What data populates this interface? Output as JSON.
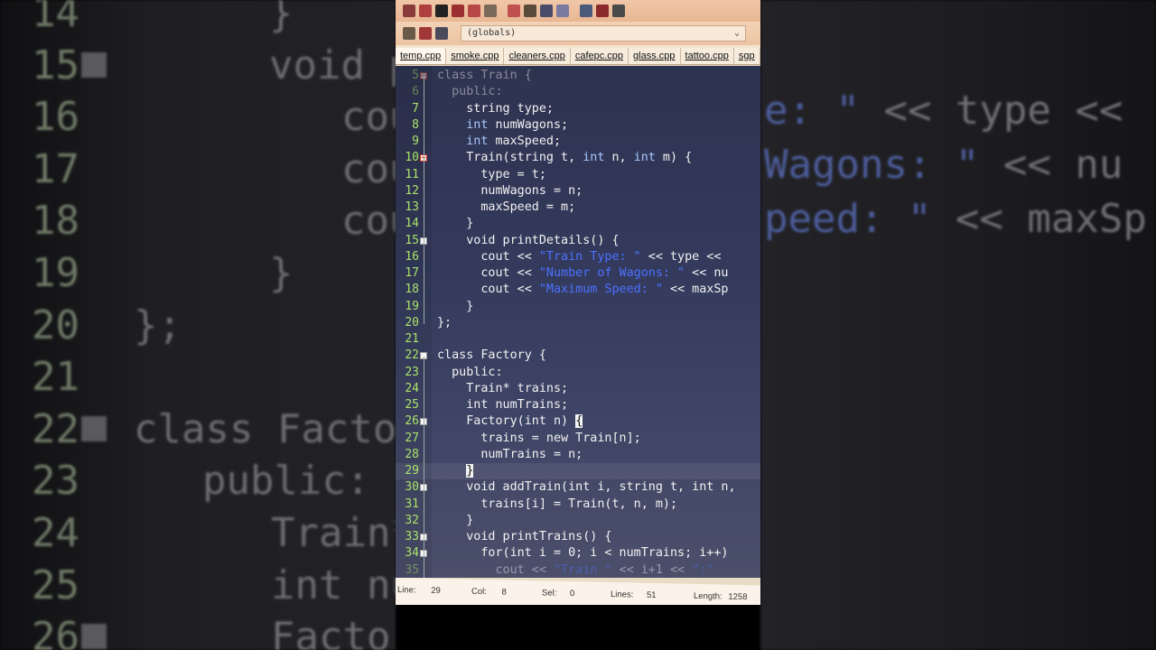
{
  "background_left": {
    "lines": [
      {
        "num": "14",
        "code": "}",
        "fold": false
      },
      {
        "num": "15",
        "code": "void p",
        "fold": true
      },
      {
        "num": "16",
        "code": "cou",
        "fold": false
      },
      {
        "num": "17",
        "code": "cou",
        "fold": false
      },
      {
        "num": "18",
        "code": "cou",
        "fold": false
      },
      {
        "num": "19",
        "code": "}",
        "fold": false
      },
      {
        "num": "20",
        "code": "};",
        "fold": false
      },
      {
        "num": "21",
        "code": "",
        "fold": false
      },
      {
        "num": "22",
        "code": "class Facto",
        "fold": true
      },
      {
        "num": "23",
        "code": "public:",
        "fold": false
      },
      {
        "num": "24",
        "code": "Train*",
        "fold": false
      },
      {
        "num": "25",
        "code": "int nu",
        "fold": false
      },
      {
        "num": "26",
        "code": "Facto",
        "fold": true
      }
    ]
  },
  "background_right": {
    "lines": [
      {
        "str": "e: \"",
        "plain": " << type <<"
      },
      {
        "str": "Wagons: \"",
        "plain": " << nu"
      },
      {
        "str": "peed: \"",
        "plain": " << maxSp"
      }
    ]
  },
  "toolbar": {
    "scope_value": "(globals)",
    "button_colors": [
      "#8a3a3a",
      "#b04040",
      "#222222",
      "#9c3030",
      "#b84848",
      "#7a6a5a",
      "#c05050",
      "#5a4a3a",
      "#4a4a6a",
      "#7a7aa0",
      "#4a5a7a",
      "#8a2a2a",
      "#4a4a4a"
    ]
  },
  "tabs": [
    "temp.cpp",
    "smoke.cpp",
    "cleaners.cpp",
    "cafepc.cpp",
    "glass.cpp",
    "tattoo.cpp",
    "sgp"
  ],
  "code_lines": [
    {
      "num": "5",
      "fold": "red",
      "segments": [
        {
          "t": "class Train {",
          "c": ""
        }
      ]
    },
    {
      "num": "6",
      "fold": "",
      "segments": [
        {
          "t": "  public:",
          "c": ""
        }
      ]
    },
    {
      "num": "7",
      "fold": "",
      "segments": [
        {
          "t": "    string type;",
          "c": ""
        }
      ]
    },
    {
      "num": "8",
      "fold": "",
      "segments": [
        {
          "t": "    int",
          "c": "kw"
        },
        {
          "t": " numWagons;",
          "c": ""
        }
      ]
    },
    {
      "num": "9",
      "fold": "",
      "segments": [
        {
          "t": "    int",
          "c": "kw"
        },
        {
          "t": " maxSpeed;",
          "c": ""
        }
      ]
    },
    {
      "num": "10",
      "fold": "red",
      "segments": [
        {
          "t": "    Train(string t, ",
          "c": ""
        },
        {
          "t": "int",
          "c": "kw"
        },
        {
          "t": " n, ",
          "c": ""
        },
        {
          "t": "int",
          "c": "kw"
        },
        {
          "t": " m) {",
          "c": ""
        }
      ]
    },
    {
      "num": "11",
      "fold": "",
      "segments": [
        {
          "t": "      type = t;",
          "c": ""
        }
      ]
    },
    {
      "num": "12",
      "fold": "",
      "segments": [
        {
          "t": "      numWagons = n;",
          "c": ""
        }
      ]
    },
    {
      "num": "13",
      "fold": "",
      "segments": [
        {
          "t": "      maxSpeed = m;",
          "c": ""
        }
      ]
    },
    {
      "num": "14",
      "fold": "",
      "segments": [
        {
          "t": "    }",
          "c": ""
        }
      ]
    },
    {
      "num": "15",
      "fold": "white",
      "segments": [
        {
          "t": "    void printDetails() {",
          "c": ""
        }
      ]
    },
    {
      "num": "16",
      "fold": "",
      "segments": [
        {
          "t": "      cout << ",
          "c": ""
        },
        {
          "t": "\"Train Type: \"",
          "c": "str"
        },
        {
          "t": " << type <<",
          "c": ""
        }
      ]
    },
    {
      "num": "17",
      "fold": "",
      "segments": [
        {
          "t": "      cout << ",
          "c": ""
        },
        {
          "t": "\"Number of Wagons: \"",
          "c": "str"
        },
        {
          "t": " << nu",
          "c": ""
        }
      ]
    },
    {
      "num": "18",
      "fold": "",
      "segments": [
        {
          "t": "      cout << ",
          "c": ""
        },
        {
          "t": "\"Maximum Speed: \"",
          "c": "str"
        },
        {
          "t": " << maxSp",
          "c": ""
        }
      ]
    },
    {
      "num": "19",
      "fold": "",
      "segments": [
        {
          "t": "    }",
          "c": ""
        }
      ]
    },
    {
      "num": "20",
      "fold": "",
      "segments": [
        {
          "t": "};",
          "c": ""
        }
      ]
    },
    {
      "num": "21",
      "fold": "",
      "segments": [
        {
          "t": "",
          "c": ""
        }
      ]
    },
    {
      "num": "22",
      "fold": "white",
      "segments": [
        {
          "t": "class Factory {",
          "c": ""
        }
      ]
    },
    {
      "num": "23",
      "fold": "",
      "segments": [
        {
          "t": "  public:",
          "c": ""
        }
      ]
    },
    {
      "num": "24",
      "fold": "",
      "segments": [
        {
          "t": "    Train* trains;",
          "c": ""
        }
      ]
    },
    {
      "num": "25",
      "fold": "",
      "segments": [
        {
          "t": "    int numTrains;",
          "c": ""
        }
      ]
    },
    {
      "num": "26",
      "fold": "white",
      "segments": [
        {
          "t": "    Factory(int n) ",
          "c": ""
        },
        {
          "t": "{",
          "c": "brace"
        }
      ]
    },
    {
      "num": "27",
      "fold": "",
      "segments": [
        {
          "t": "      trains = new Train[n];",
          "c": ""
        }
      ]
    },
    {
      "num": "28",
      "fold": "",
      "segments": [
        {
          "t": "      numTrains = n;",
          "c": ""
        }
      ]
    },
    {
      "num": "29",
      "fold": "",
      "segments": [
        {
          "t": "    ",
          "c": ""
        },
        {
          "t": "}",
          "c": "brace"
        }
      ]
    },
    {
      "num": "30",
      "fold": "white",
      "segments": [
        {
          "t": "    void addTrain(int i, string t, int n,",
          "c": ""
        }
      ]
    },
    {
      "num": "31",
      "fold": "",
      "segments": [
        {
          "t": "      trains[i] = Train(t, n, m);",
          "c": ""
        }
      ]
    },
    {
      "num": "32",
      "fold": "",
      "segments": [
        {
          "t": "    }",
          "c": ""
        }
      ]
    },
    {
      "num": "33",
      "fold": "white",
      "segments": [
        {
          "t": "    void printTrains() {",
          "c": ""
        }
      ]
    },
    {
      "num": "34",
      "fold": "white",
      "segments": [
        {
          "t": "      for(int i = 0; i < numTrains; i++)",
          "c": ""
        }
      ]
    },
    {
      "num": "35",
      "fold": "",
      "segments": [
        {
          "t": "        cout << ",
          "c": ""
        },
        {
          "t": "\"Train \"",
          "c": "str"
        },
        {
          "t": " << i+1 << ",
          "c": ""
        },
        {
          "t": "\":\"",
          "c": "str"
        }
      ]
    }
  ],
  "status": {
    "line_label": "Line:",
    "line_value": "29",
    "col_label": "Col:",
    "col_value": "8",
    "sel_label": "Sel:",
    "sel_value": "0",
    "lines_label": "Lines:",
    "lines_value": "51",
    "length_label": "Length:",
    "length_value": "1258"
  }
}
